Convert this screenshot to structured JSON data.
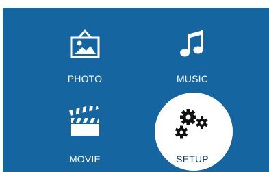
{
  "menu": {
    "items": [
      {
        "id": "photo",
        "label": "PHOTO",
        "icon": "photo-frame-icon",
        "selected": false
      },
      {
        "id": "music",
        "label": "MUSIC",
        "icon": "music-note-icon",
        "selected": false
      },
      {
        "id": "movie",
        "label": "MOVIE",
        "icon": "clapperboard-icon",
        "selected": false
      },
      {
        "id": "setup",
        "label": "SETUP",
        "icon": "gears-icon",
        "selected": true
      }
    ]
  },
  "colors": {
    "background": "#1566a0",
    "foreground": "#ffffff",
    "selected_text": "#0e3c64"
  }
}
